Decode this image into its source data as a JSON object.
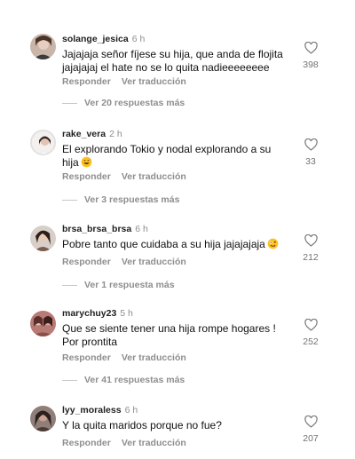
{
  "action_labels": {
    "reply": "Responder",
    "translate": "Ver traducción"
  },
  "comments": [
    {
      "username": "solange_jesica",
      "time": "6 h",
      "text_lines": [
        "Jajajaja señor fíjese su hija, que anda de flojita",
        "jajajajaj el hate no se lo quita nadieeeeeeee"
      ],
      "likes": "398",
      "replies": "Ver 20 respuestas más"
    },
    {
      "username": "rake_vera",
      "time": "2 h",
      "text_lines": [
        "El explorando Tokio y nodal explorando a su",
        "hija"
      ],
      "emoji": "grinning-sweat-emoji",
      "likes": "33",
      "replies": "Ver 3 respuestas más"
    },
    {
      "username": "brsa_brsa_brsa",
      "time": "6 h",
      "text_lines": [
        "Pobre tanto que cuidaba a su hija jajajajaja"
      ],
      "emoji": "zany-face-emoji",
      "likes": "212",
      "replies": "Ver 1 respuesta más"
    },
    {
      "username": "marychuy23",
      "time": "5 h",
      "text_lines": [
        "Que se siente tener una hija rompe hogares !",
        "Por prontita"
      ],
      "likes": "252",
      "replies": "Ver 41 respuestas más"
    },
    {
      "username": "lyy_moraless",
      "time": "6 h",
      "text_lines": [
        "Y la quita maridos porque no fue?"
      ],
      "likes": "207"
    }
  ],
  "colors": {
    "primary_text": "#111111",
    "secondary_text": "#8e8e8e",
    "divider": "#c7c7c7",
    "background": "#ffffff"
  }
}
